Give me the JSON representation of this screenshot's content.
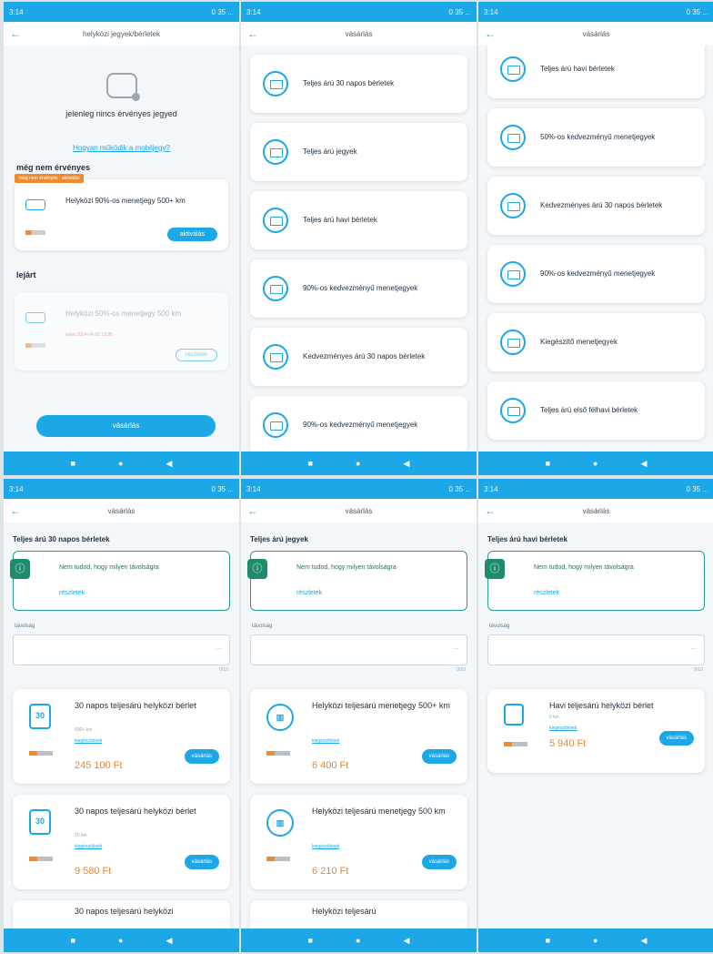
{
  "status": {
    "time": "3:14",
    "right": "0 35 ..."
  },
  "screen1": {
    "title": "helyközi jegyek/bérletek",
    "no_ticket": "jelenleg nincs érvényes jegyed",
    "help_link": "Hogyan működik a mobiljegy?",
    "not_valid_yet": "még nem érvényes",
    "tag": "még nem érvényes · aktiválás",
    "ticket1": "Helyközi 90%-os menetjegy 500+ km",
    "activate": "aktiválás",
    "expired": "lejárt",
    "ticket2": "Helyközi 50%-os menetjegy 500 km",
    "ticket2_dates": "lejárt 2024-04-02 13:35",
    "details": "részletek",
    "buy": "vásárlás"
  },
  "screen2": {
    "title": "vásárlás",
    "items": [
      "Teljes árú 30 napos bérletek",
      "Teljes árú jegyek",
      "Teljes árú havi bérletek",
      "90%-os kedvezményű menetjegyek",
      "Kedvezményes árú 30 napos bérletek",
      "90%-os kedvezményű menetjegyek"
    ]
  },
  "screen3": {
    "title": "vásárlás",
    "items": [
      "Teljes árú havi bérletek",
      "50%-os kedvezményű menetjegyek",
      "Kedvezményes árú 30 napos bérletek",
      "90%-os kedvezményű menetjegyek",
      "Kiegészítő menetjegyek",
      "Teljes árú első félhavi bérletek"
    ]
  },
  "screen4": {
    "title": "vásárlás",
    "heading": "Teljes árú 30 napos bérletek",
    "info": "Nem tudod, hogy milyen távolságra",
    "info_link": "részletek",
    "field_label": "távolság",
    "count": "0/10",
    "p1": {
      "icon": "30",
      "name": "30 napos teljesárú helyközi bérlet",
      "sub": "500+ km",
      "link": "kiegészítések",
      "price": "245 100 Ft",
      "btn": "vásárlás"
    },
    "p2": {
      "icon": "30",
      "name": "30 napos teljesárú helyközi bérlet",
      "sub": "10 km",
      "link": "kiegészítések",
      "price": "9 580 Ft",
      "btn": "vásárlás"
    },
    "p3": {
      "name": "30 napos teljesárú helyközi"
    }
  },
  "screen5": {
    "title": "vásárlás",
    "heading": "Teljes árú jegyek",
    "info": "Nem tudod, hogy milyen távolságra",
    "info_link": "részletek",
    "field_label": "távolság",
    "count": "0/10",
    "p1": {
      "name": "Helyközi teljesárú menetjegy 500+ km",
      "link": "kiegészítések",
      "price": "6 400 Ft",
      "btn": "vásárlás"
    },
    "p2": {
      "name": "Helyközi teljesárú menetjegy 500 km",
      "link": "kiegészítések",
      "price": "6 210 Ft",
      "btn": "vásárlás"
    },
    "p3": {
      "name": "Helyközi teljesárú"
    }
  },
  "screen6": {
    "title": "vásárlás",
    "heading": "Teljes árú havi bérletek",
    "info": "Nem tudod, hogy milyen távolságra",
    "info_link": "részletek",
    "field_label": "távolság",
    "count": "0/10",
    "p1": {
      "name": "Havi teljesárú helyközi bérlet",
      "sub": "5 km",
      "link": "kiegészítések",
      "price": "5 940 Ft",
      "btn": "vásárlás"
    }
  },
  "colors": {
    "accent": "#1ca7e6",
    "price": "#e0893a",
    "info": "#1e8a6e",
    "tag": "#f08b2c"
  }
}
